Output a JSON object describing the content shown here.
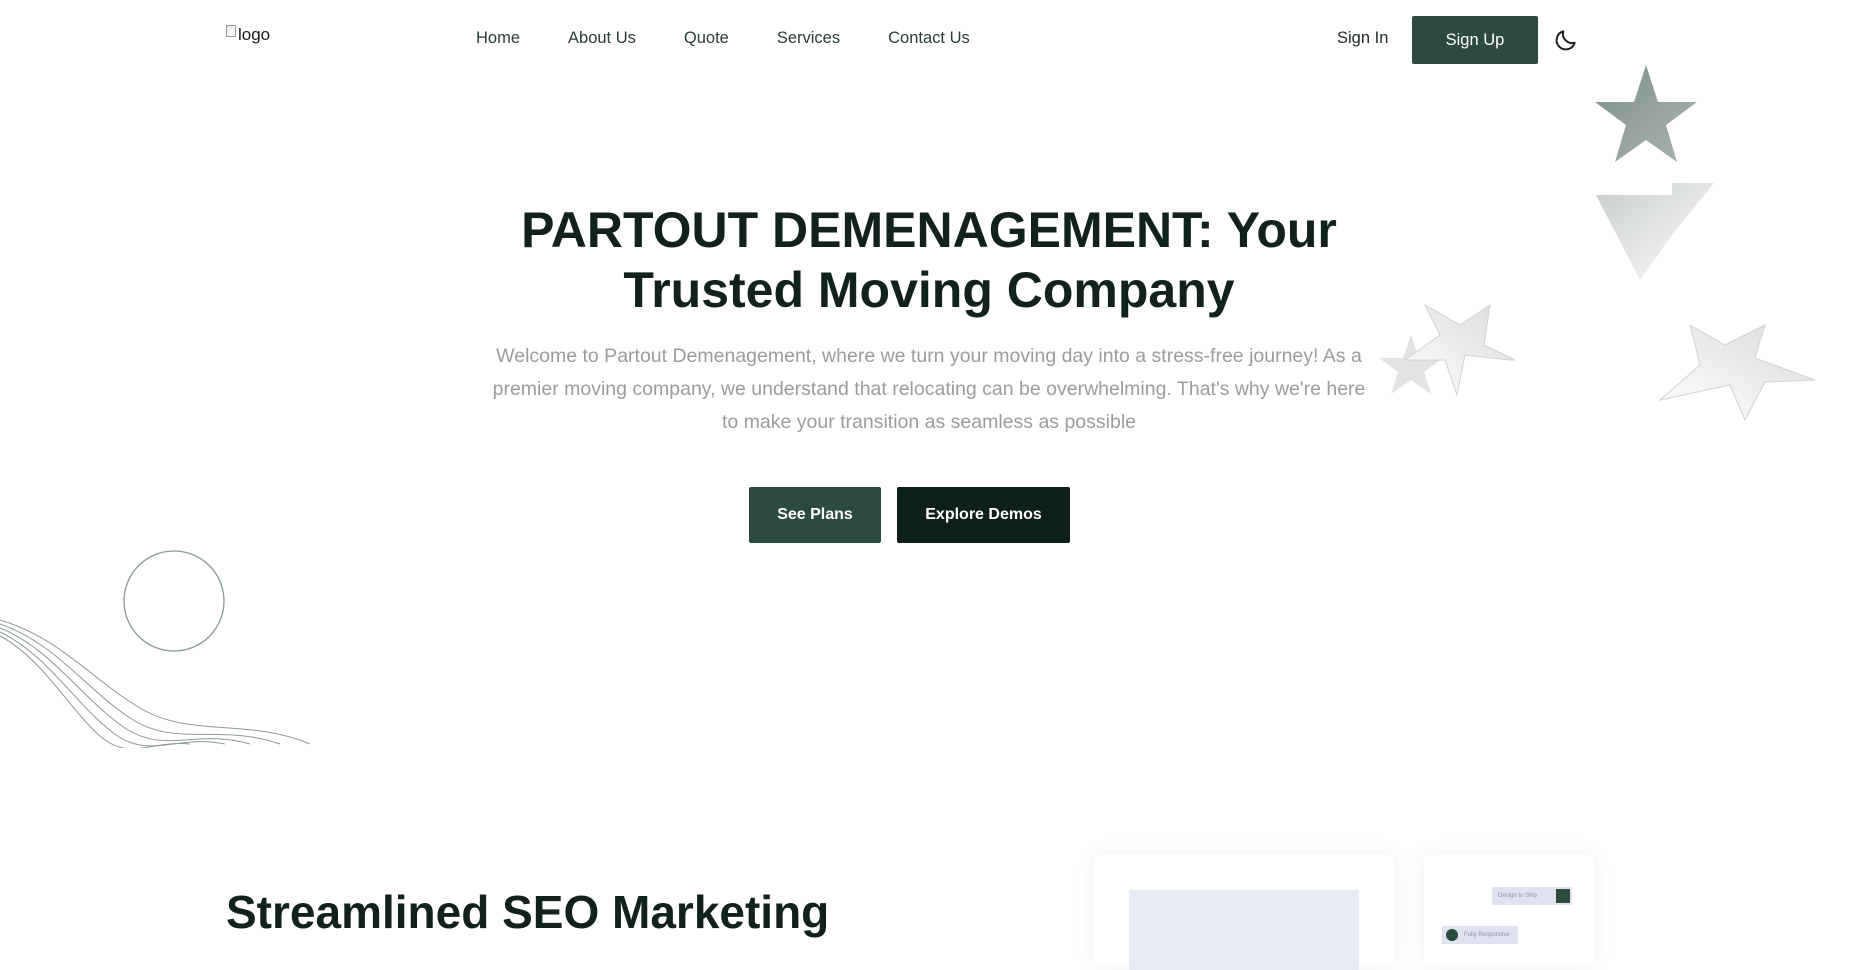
{
  "header": {
    "logo_alt": "logo",
    "nav": [
      {
        "label": "Home"
      },
      {
        "label": "About Us"
      },
      {
        "label": "Quote"
      },
      {
        "label": "Services"
      },
      {
        "label": "Contact Us"
      }
    ],
    "sign_in": "Sign In",
    "sign_up": "Sign Up",
    "theme_icon": "moon-icon"
  },
  "hero": {
    "title": "PARTOUT DEMENAGEMENT: Your Trusted Moving Company",
    "subtitle": "Welcome to Partout Demenagement, where we turn your moving day into a stress-free journey! As a premier moving company, we understand that relocating can be overwhelming. That's why we're here to make your transition as seamless as possible",
    "primary_button": "See Plans",
    "secondary_button": "Explore Demos"
  },
  "section": {
    "title": "Streamlined SEO Marketing",
    "mini_tag": "Design to Ship",
    "mini_chip": "Fully Responsive"
  },
  "colors": {
    "primary": "#2c4a3e",
    "dark": "#0f201a",
    "text": "#10221b",
    "muted": "#9c9c9c"
  }
}
